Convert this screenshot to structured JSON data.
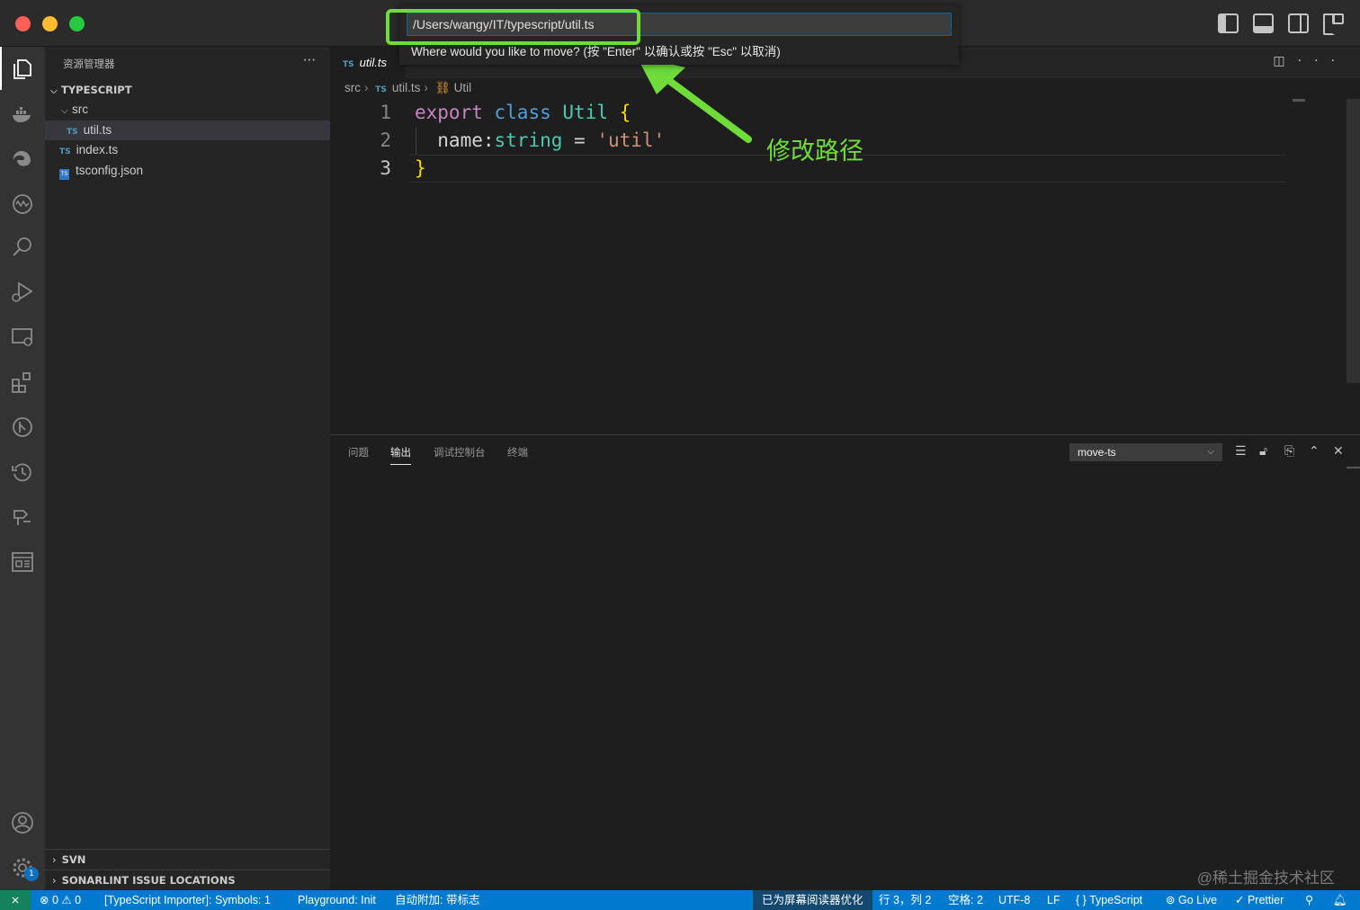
{
  "titlebar": {
    "layout_icons": [
      "toggle-primary-sidebar-icon",
      "toggle-panel-icon",
      "toggle-secondary-sidebar-icon",
      "customize-layout-icon"
    ]
  },
  "quick_input": {
    "value": "/Users/wangy/IT/typescript/util.ts",
    "hint": "Where would you like to move? (按 \"Enter\" 以确认或按 \"Esc\" 以取消)"
  },
  "annotation": {
    "text": "修改路径",
    "color": "#6fdc3a"
  },
  "sidebar": {
    "title": "资源管理器",
    "more": "···",
    "root": "TYPESCRIPT",
    "tree": [
      {
        "name": "src",
        "kind": "folder"
      },
      {
        "name": "util.ts",
        "kind": "ts",
        "selected": true
      },
      {
        "name": "index.ts",
        "kind": "ts"
      },
      {
        "name": "tsconfig.json",
        "kind": "json"
      }
    ],
    "ts_badge": "TS",
    "json_badge": "TS",
    "sections": [
      "SVN",
      "SONARLINT ISSUE LOCATIONS"
    ]
  },
  "editor": {
    "tab": {
      "badge": "TS",
      "label": "util.ts"
    },
    "breadcrumb": {
      "folder": "src",
      "file_badge": "TS",
      "file": "util.ts",
      "symbol": "Util"
    },
    "lines": [
      {
        "num": "1",
        "tokens": [
          [
            "kw",
            "export"
          ],
          [
            "p",
            " "
          ],
          [
            "kw2",
            "class"
          ],
          [
            "p",
            " "
          ],
          [
            "cls",
            "Util"
          ],
          [
            "p",
            " "
          ],
          [
            "brace",
            "{"
          ]
        ]
      },
      {
        "num": "2",
        "tokens": [
          [
            "p",
            "  name:"
          ],
          [
            "typ",
            "string"
          ],
          [
            "p",
            " = "
          ],
          [
            "str",
            "'util'"
          ]
        ]
      },
      {
        "num": "3",
        "tokens": [
          [
            "brace",
            "}"
          ]
        ]
      }
    ]
  },
  "panel": {
    "tabs": [
      "问题",
      "输出",
      "调试控制台",
      "终端"
    ],
    "active_tab": "输出",
    "output_channel": "move-ts"
  },
  "watermark": "@稀土掘金技术社区",
  "statusbar": {
    "errors": "0",
    "warnings": "0",
    "items_left": [
      "[TypeScript Importer]: Symbols: 1",
      "Playground: Init",
      "自动附加: 带标志"
    ],
    "screen_reader": "已为屏幕阅读器优化",
    "position": "行 3，列 2",
    "spaces": "空格: 2",
    "encoding": "UTF-8",
    "eol": "LF",
    "language": "TypeScript",
    "golive": "Go Live",
    "prettier": "Prettier"
  },
  "activity_badge": "1"
}
